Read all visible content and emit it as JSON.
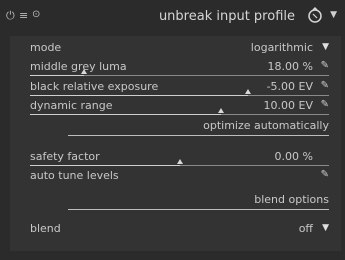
{
  "header": {
    "title": "unbreak input profile"
  },
  "params": {
    "mode": {
      "label": "mode",
      "value": "logarithmic"
    },
    "middle_grey_luma": {
      "label": "middle grey luma",
      "value": "18.00 %",
      "position": 0.18
    },
    "black_relative_exposure": {
      "label": "black relative exposure",
      "value": "-5.00 EV",
      "position": 0.73
    },
    "dynamic_range": {
      "label": "dynamic range",
      "value": "10.00 EV",
      "position": 0.64
    },
    "optimize_button": "optimize automatically",
    "safety_factor": {
      "label": "safety factor",
      "value": "0.00 %",
      "position": 0.5
    },
    "auto_tune_levels": {
      "label": "auto tune levels"
    },
    "blend_options_button": "blend options",
    "blend": {
      "label": "blend",
      "value": "off"
    }
  },
  "colors": {
    "background": "#2b2b2b",
    "panel": "#333333",
    "text": "#c8c8c8"
  }
}
